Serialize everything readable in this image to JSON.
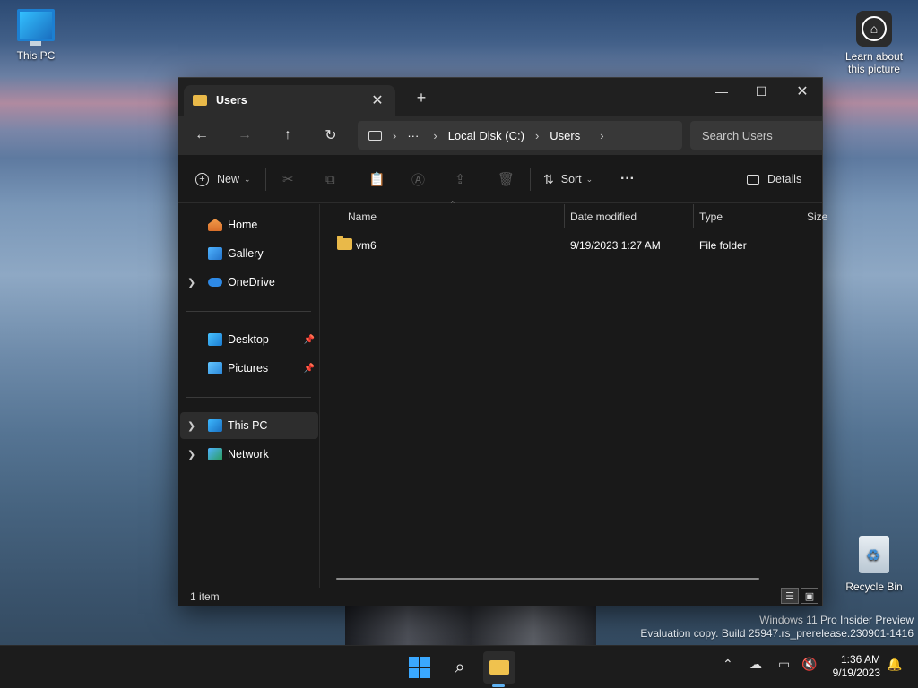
{
  "desktop": {
    "icons": [
      {
        "label": "This PC"
      },
      {
        "label": "Learn about this picture"
      },
      {
        "label": "Recycle Bin"
      }
    ],
    "watermark": {
      "line1": "Windows 11 Pro Insider Preview",
      "line2": "Evaluation copy. Build 25947.rs_prerelease.230901-1416"
    }
  },
  "window": {
    "tab_title": "Users",
    "tab_close": "✕",
    "new_tab": "+",
    "controls": {
      "minimize": "—",
      "maximize": "☐",
      "close": "✕"
    },
    "nav": {
      "back": "←",
      "forward": "→",
      "up": "↑",
      "refresh": "↻"
    },
    "address": {
      "more": "···",
      "crumbs": [
        "Local Disk (C:)",
        "Users"
      ],
      "sep": "›"
    },
    "search_placeholder": "Search Users",
    "commands": {
      "new": "New",
      "sort": "Sort",
      "more": "···",
      "details": "Details"
    },
    "sidebar": [
      {
        "label": "Home"
      },
      {
        "label": "Gallery"
      },
      {
        "label": "OneDrive"
      },
      {
        "label": "Desktop"
      },
      {
        "label": "Pictures"
      },
      {
        "label": "This PC"
      },
      {
        "label": "Network"
      }
    ],
    "columns": [
      "Name",
      "Date modified",
      "Type",
      "Size"
    ],
    "rows": [
      {
        "name": "vm6",
        "date": "9/19/2023 1:27 AM",
        "type": "File folder",
        "size": ""
      }
    ],
    "status": "1 item"
  },
  "taskbar": {
    "time": "1:36 AM",
    "date": "9/19/2023"
  },
  "colors": {
    "accent": "#3aa8ff",
    "folder": "#e9b949",
    "window_bg": "#191919"
  }
}
